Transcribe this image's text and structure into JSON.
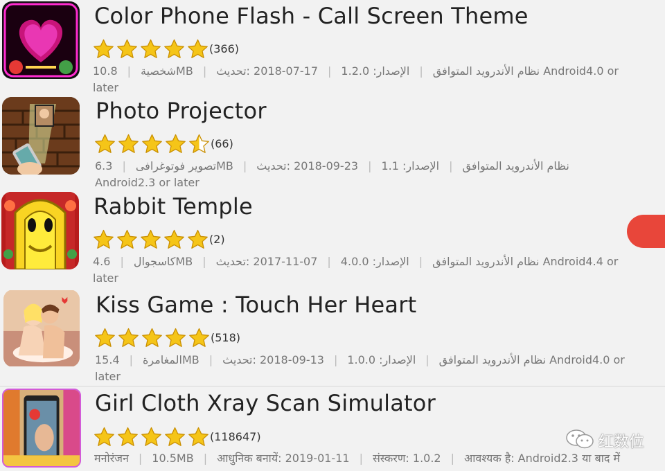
{
  "apps": [
    {
      "title": "Color Phone Flash - Call Screen Theme",
      "icon": "color-phone-flash-icon",
      "rating": 5,
      "reviews": "(366)",
      "size": "10.8",
      "category": "شخصيةMB",
      "compat": "نظام الأندرويد المتوافق",
      "version": "الإصدار: 1.2.0",
      "updated": "17-07-2018 :تحديث",
      "requires": "Android4.0 or later"
    },
    {
      "title": "Photo Projector",
      "icon": "photo-projector-icon",
      "rating": 4.5,
      "reviews": "(66)",
      "size": "6.3",
      "category": "تصوير فوتوغرافىMB",
      "compat": "نظام الأندرويد المتوافق",
      "version": "الإصدار: 1.1",
      "updated": "23-09-2018 :تحديث",
      "requires": "Android2.3 or later"
    },
    {
      "title": "Rabbit Temple",
      "icon": "rabbit-temple-icon",
      "rating": 5,
      "reviews": "(2)",
      "size": "4.6",
      "category": "كاسجوالMB",
      "compat": "نظام الأندرويد المتوافق",
      "version": "الإصدار: 4.0.0",
      "updated": "07-11-2017 :تحديث",
      "requires": "Android4.4 or later"
    },
    {
      "title": "Kiss Game : Touch Her Heart",
      "icon": "kiss-game-icon",
      "rating": 5,
      "reviews": "(518)",
      "size": "15.4",
      "category": "المغامرةMB",
      "compat": "نظام الأندرويد المتوافق",
      "version": "الإصدار: 1.0.0",
      "updated": "13-09-2018 :تحديث",
      "requires": "Android4.0 or later"
    },
    {
      "title": "Girl Cloth Xray Scan Simulator",
      "icon": "xray-scan-icon",
      "rating": 5,
      "reviews": "(118647)",
      "size": "मनोरंजन",
      "category": "10.5MB",
      "compat": "आधुनिक बनायें: 2019-01-11",
      "version": "संस्करण: 1.0.2",
      "updated": "आवश्यक है: Android2.3 या बाद में",
      "requires": ""
    }
  ],
  "watermark": {
    "text": "红数位",
    "icon": "wechat-icon"
  },
  "colors": {
    "star": "#f5c518",
    "star_outline": "#c98f00",
    "accent": "#e8463a"
  }
}
